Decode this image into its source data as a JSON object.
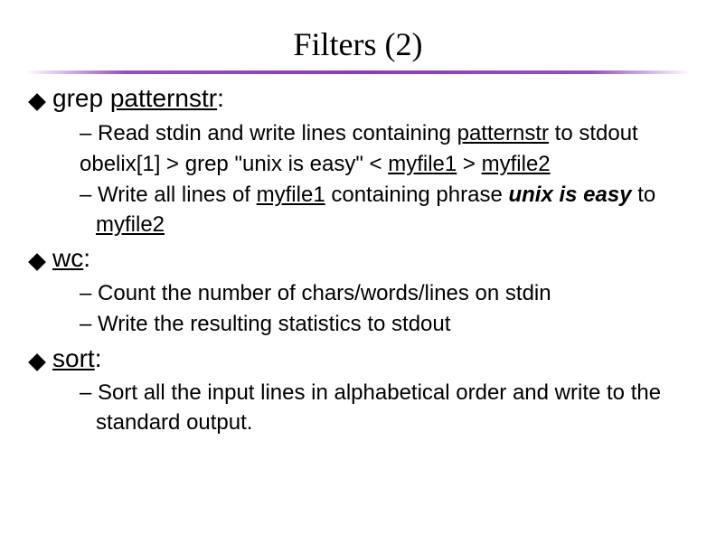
{
  "title": "Filters (2)",
  "sections": [
    {
      "heading_parts": [
        "grep ",
        "patternstr",
        ":"
      ],
      "subs": [
        {
          "type": "dash",
          "segments": [
            {
              "t": "– Read stdin and write lines containing "
            },
            {
              "t": "patternstr",
              "cls": "u"
            },
            {
              "t": " to stdout"
            }
          ]
        },
        {
          "type": "plain",
          "segments": [
            {
              "t": "obelix[1] > grep \"unix is easy\"  < "
            },
            {
              "t": "myfile1",
              "cls": "u"
            },
            {
              "t": "  > "
            },
            {
              "t": "myfile2",
              "cls": "u"
            }
          ]
        },
        {
          "type": "dash",
          "segments": [
            {
              "t": "– Write all lines of "
            },
            {
              "t": "myfile1",
              "cls": "u"
            },
            {
              "t": " containing phrase "
            },
            {
              "t": "unix is easy",
              "cls": "bi"
            },
            {
              "t": " to "
            },
            {
              "t": "myfile2",
              "cls": "u"
            }
          ]
        }
      ]
    },
    {
      "heading_parts": [
        "wc",
        ":"
      ],
      "heading_underlined": true,
      "subs": [
        {
          "type": "dash",
          "segments": [
            {
              "t": "– Count the number of chars/words/lines on stdin"
            }
          ]
        },
        {
          "type": "dash",
          "segments": [
            {
              "t": "– Write the resulting statistics to stdout"
            }
          ]
        }
      ]
    },
    {
      "heading_parts": [
        "sort",
        ":"
      ],
      "heading_underlined": true,
      "subs": [
        {
          "type": "dash",
          "segments": [
            {
              "t": "– Sort all the input lines in alphabetical order and write to the standard output."
            }
          ]
        }
      ]
    }
  ]
}
